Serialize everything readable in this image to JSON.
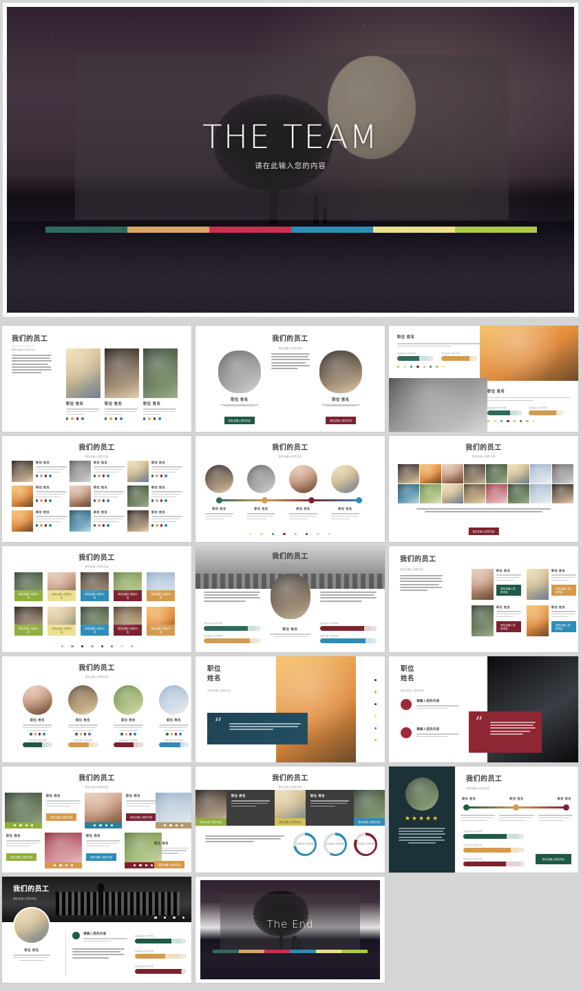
{
  "hero": {
    "title": "THE TEAM",
    "subtitle": "请在此输入您的内容",
    "palette": [
      "#2f6b5c",
      "#dba469",
      "#c8304f",
      "#2e8cb8",
      "#ece08c",
      "#aec94a"
    ]
  },
  "common": {
    "slide_title": "我们的员工",
    "slide_subtitle": "请在此输入您的内容",
    "person_name": "职位 姓名",
    "person_desc": "请在此输入您的内容请在此输入您的内容，请在此输入您的内容",
    "button_label": "请在此输入您的内容",
    "bar_caption": "请在此输入您的内容",
    "body_paragraph": "请在此输入您的内容，请在此，请在此输入您的内容，请在此输入您的内容，请在此，请在此输入您的内容，请在此输入您的内容",
    "headline_small": "请输入您的内容",
    "job_title_line1": "职位",
    "job_title_line2": "姓名",
    "quote_text": "请在此输入您的内容，请在此输入您的内容，请在此输入您的内容，请在此输入您的内容",
    "rating": "★★★★★"
  },
  "end": {
    "title": "The End"
  },
  "slides": [
    {
      "n": 1,
      "layout": "three-cards-left-text",
      "title": "我们的员工"
    },
    {
      "n": 2,
      "layout": "two-circles-center-text",
      "title": "我们的员工"
    },
    {
      "n": 3,
      "layout": "split-photo-bars",
      "title": "职位 姓名"
    },
    {
      "n": 4,
      "layout": "nine-grid-list",
      "title": "我们的员工"
    },
    {
      "n": 5,
      "layout": "four-circles-timeline",
      "title": "我们的员工"
    },
    {
      "n": 6,
      "layout": "photo-mosaic",
      "title": "我们的员工"
    },
    {
      "n": 7,
      "layout": "ten-photo-buttons",
      "title": "我们的员工"
    },
    {
      "n": 8,
      "layout": "hero-photo-bars",
      "title": "我们的员工"
    },
    {
      "n": 9,
      "layout": "text-left-four-cards",
      "title": "我们的员工"
    },
    {
      "n": 10,
      "layout": "four-circle-profiles",
      "title": "我们的员工"
    },
    {
      "n": 11,
      "layout": "quote-light",
      "title": "职位 姓名"
    },
    {
      "n": 12,
      "layout": "quote-dark",
      "title": "职位 姓名"
    },
    {
      "n": 13,
      "layout": "six-tile-mix",
      "title": "我们的员工"
    },
    {
      "n": 14,
      "layout": "strip-and-rings",
      "title": "我们的员工"
    },
    {
      "n": 15,
      "layout": "dark-profile-timeline",
      "title": "我们的员工"
    },
    {
      "n": 16,
      "layout": "city-banner-profile",
      "title": "我们的员工"
    },
    {
      "n": 17,
      "layout": "the-end",
      "title": "The End"
    }
  ],
  "accents": {
    "green": "#2f6b5c",
    "dark_green": "#1f5a46",
    "tan": "#d49a4e",
    "crimson": "#7d2230",
    "blue": "#2e8cb8",
    "yellow": "#ece08c",
    "olive": "#8fae3c",
    "navy": "#1d3238",
    "red": "#9e2b3a"
  }
}
